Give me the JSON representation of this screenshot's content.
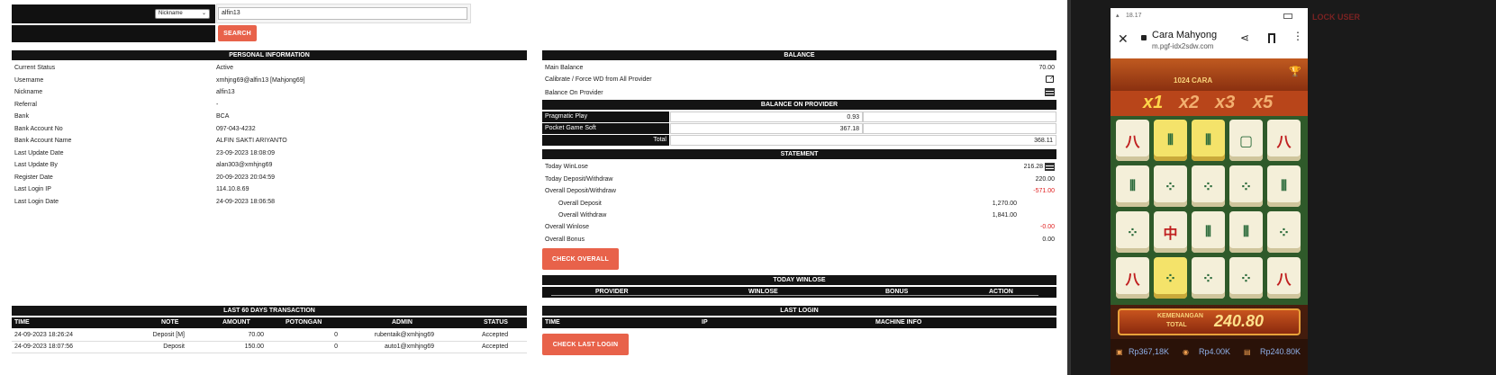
{
  "search": {
    "select_value": "Nickname",
    "input_value": "alfin13",
    "button_label": "SEARCH"
  },
  "personal": {
    "title": "PERSONAL INFORMATION",
    "rows": [
      {
        "label": "Current Status",
        "value": "Active"
      },
      {
        "label": "Username",
        "value": "xmhjng69@alfin13  [Mahjong69]"
      },
      {
        "label": "Nickname",
        "value": "alfin13"
      },
      {
        "label": "Referral",
        "value": "-"
      },
      {
        "label": "Bank",
        "value": "BCA"
      },
      {
        "label": "Bank Account No",
        "value": "097-043-4232"
      },
      {
        "label": "Bank Account Name",
        "value": "ALFIN SAKTI ARIYANTO"
      },
      {
        "label": "Last Update Date",
        "value": "23-09-2023 18:08:09"
      },
      {
        "label": "Last Update By",
        "value": "alan303@xmhjng69"
      },
      {
        "label": "Register Date",
        "value": "20-09-2023 20:04:59"
      },
      {
        "label": "Last Login IP",
        "value": "114.10.8.69"
      },
      {
        "label": "Last Login Date",
        "value": "24-09-2023 18:06:58"
      }
    ]
  },
  "balance": {
    "title": "BALANCE",
    "main_label": "Main Balance",
    "main_value": "70.00",
    "calibrate_label": "Calibrate / Force WD from All Provider",
    "provider_label": "Balance On Provider",
    "on_provider_title": "BALANCE ON PROVIDER",
    "providers": [
      {
        "name": "Pragmatic Play",
        "value": "0.93"
      },
      {
        "name": "Pocket Game Soft",
        "value": "367.18"
      }
    ],
    "total_label": "Total",
    "total_value": "368.11"
  },
  "statement": {
    "title": "STATEMENT",
    "today_winlose_label": "Today WinLose",
    "today_winlose_value": "216.28",
    "today_dw_label": "Today Deposit/Withdraw",
    "today_dw_value": "220.00",
    "overall_dw_label": "Overall Deposit/Withdraw",
    "overall_dw_value": "-571.00",
    "overall_deposit_label": "Overall Deposit",
    "overall_deposit_value": "1,270.00",
    "overall_withdraw_label": "Overall Withdraw",
    "overall_withdraw_value": "1,841.00",
    "overall_winlose_label": "Overall Winlose",
    "overall_winlose_value": "-0.00",
    "overall_bonus_label": "Overall Bonus",
    "overall_bonus_value": "0.00",
    "check_overall_label": "CHECK OVERALL"
  },
  "today_winlose": {
    "title": "TODAY WINLOSE",
    "columns": [
      "PROVIDER",
      "WINLOSE",
      "BONUS",
      "ACTION"
    ]
  },
  "last_login": {
    "title": "LAST LOGIN",
    "columns": [
      "TIME",
      "IP",
      "MACHINE INFO"
    ],
    "button_label": "CHECK LAST LOGIN"
  },
  "transactions": {
    "title": "LAST 60 DAYS TRANSACTION",
    "columns": [
      "TIME",
      "NOTE",
      "AMOUNT",
      "POTONGAN",
      "ADMIN",
      "STATUS"
    ],
    "rows": [
      [
        "24-09-2023 18:26:24",
        "Deposit [M]",
        "70.00",
        "0",
        "rubentaik@xmhjng69",
        "Accepted"
      ],
      [
        "24-09-2023 18:07:56",
        "Deposit",
        "150.00",
        "0",
        "auto1@xmhjng69",
        "Accepted"
      ]
    ]
  },
  "phone": {
    "time": "18.17",
    "page_title": "Cara Mahyong",
    "url": "m.pgf-idx2sdw.com",
    "game_banner": "1024 CARA",
    "multipliers": [
      "x1",
      "x2",
      "x3",
      "x5"
    ],
    "win_label_top": "KEMENANGAN",
    "win_label_bottom": "TOTAL",
    "win_value": "240.80",
    "footer": [
      "Rp367,18K",
      "Rp4.00K",
      "Rp240.80K"
    ],
    "bg_text": "LOCK USER"
  },
  "colors": {
    "accent": "#e8624a",
    "header": "#141414",
    "negative": "#e02020"
  }
}
